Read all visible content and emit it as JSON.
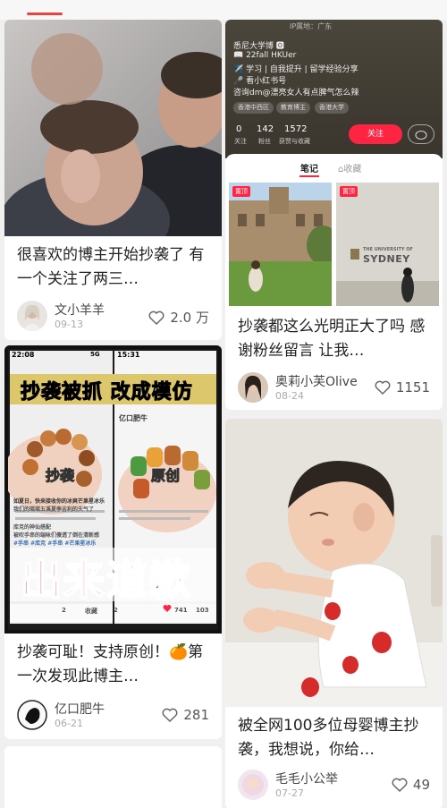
{
  "feed": {
    "left": [
      {
        "title": "很喜欢的博主开始抄袭了 有一个关注了两三…",
        "author": "文小羊羊",
        "date": "09-13",
        "likes": "2.0 万"
      },
      {
        "cover_status_time": "22:08",
        "cover_status_signal": "5G",
        "cover_status_time2": "15:31",
        "cover_headline": "抄袭被抓 改成模仿",
        "cover_label_copy": "抄袭",
        "cover_label_original": "原创",
        "cover_shop_name": "亿口肥牛",
        "cover_text_1": "如夏日，快来接收你的冰爽芒果星冰乐",
        "cover_text_2": "我们的瑶瑶五溪夏季吉利的天气了",
        "cover_text_3": "库克的神仙搭配",
        "cover_text_4": "被吹手串的端咏们傻透了倒在清新感",
        "cover_text_5": "#手串 #库克 #手串 #芒果星冰乐",
        "cover_big_text": "出来道歉",
        "cover_bottom_left": "2",
        "cover_bottom_collect": "收藏",
        "cover_bottom_comment": "2",
        "cover_bottom_likes": "741",
        "cover_bottom_stars": "103",
        "title": "抄袭可耻！支持原创！🍊第一次发现此博主…",
        "author": "亿口肥牛",
        "date": "06-21",
        "likes": "281"
      }
    ],
    "right": [
      {
        "profile": {
          "ip_location": "IP属地：广东",
          "bio_1": "悉尼大学博 🅾",
          "bio_2": "📖 22fall HKUer",
          "bio_3": "✈️ 学习 | 自我提升 | 留学经验分享",
          "bio_4": "🎤 看小红书号",
          "bio_5": "咨询dm@漂亮女人有点脾气怎么辣",
          "tags": [
            "香港中西区",
            "教育博主",
            "香港大学"
          ],
          "stats": [
            {
              "num": "0",
              "label": "关注"
            },
            {
              "num": "142",
              "label": "粉丝"
            },
            {
              "num": "1572",
              "label": "获赞与收藏"
            }
          ],
          "follow_label": "关注",
          "subtab_notes": "笔记",
          "subtab_collect": "收藏",
          "pin_label": "置顶",
          "pin_label_2": "置顶",
          "sign_1": "THE UNIVERSITY OF",
          "sign_2": "SYDNEY"
        },
        "title": "抄袭都这么光明正大了吗 感谢粉丝留言 让我…",
        "author": "奥莉小芙Olive",
        "date": "08-24",
        "likes": "1151"
      },
      {
        "title": "被全网100多位母婴博主抄袭，我想说，你给…",
        "author": "毛毛小公举",
        "date": "07-27",
        "likes": "49"
      }
    ]
  },
  "colors": {
    "accent": "#ff2442",
    "top_accent": "#e8433f"
  }
}
